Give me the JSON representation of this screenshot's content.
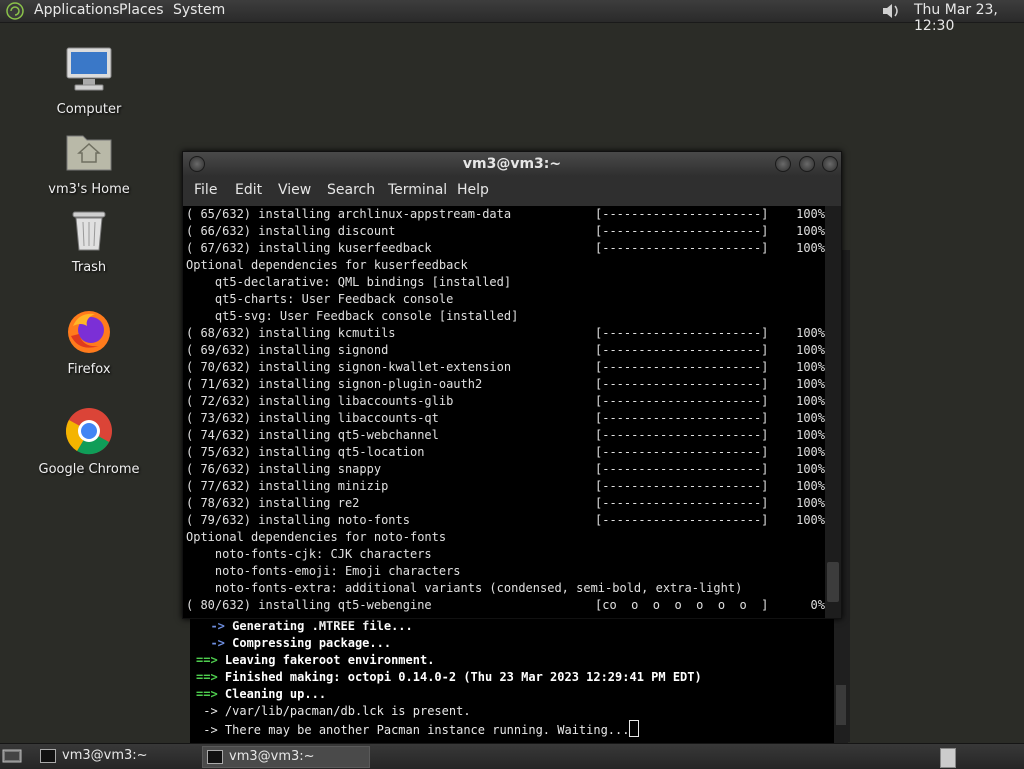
{
  "top_panel": {
    "menus": [
      "Applications",
      "Places",
      "System"
    ],
    "clock": "Thu Mar 23, 12:30"
  },
  "desktop_icons": [
    {
      "label": "Computer",
      "icon": "computer-icon"
    },
    {
      "label": "vm3's Home",
      "icon": "home-folder-icon"
    },
    {
      "label": "Trash",
      "icon": "trash-icon"
    },
    {
      "label": "Firefox",
      "icon": "firefox-icon"
    },
    {
      "label": "Google Chrome",
      "icon": "chrome-icon"
    }
  ],
  "terminal_front": {
    "title": "vm3@vm3:~",
    "menu": [
      "File",
      "Edit",
      "View",
      "Search",
      "Terminal",
      "Help"
    ],
    "lines": [
      {
        "text": "( 65/632) installing archlinux-appstream-data",
        "bar": "[----------------------]",
        "pct": "100%"
      },
      {
        "text": "( 66/632) installing discount",
        "bar": "[----------------------]",
        "pct": "100%"
      },
      {
        "text": "( 67/632) installing kuserfeedback",
        "bar": "[----------------------]",
        "pct": "100%"
      },
      {
        "text": "Optional dependencies for kuserfeedback"
      },
      {
        "text": "    qt5-declarative: QML bindings [installed]"
      },
      {
        "text": "    qt5-charts: User Feedback console"
      },
      {
        "text": "    qt5-svg: User Feedback console [installed]"
      },
      {
        "text": "( 68/632) installing kcmutils",
        "bar": "[----------------------]",
        "pct": "100%"
      },
      {
        "text": "( 69/632) installing signond",
        "bar": "[----------------------]",
        "pct": "100%"
      },
      {
        "text": "( 70/632) installing signon-kwallet-extension",
        "bar": "[----------------------]",
        "pct": "100%"
      },
      {
        "text": "( 71/632) installing signon-plugin-oauth2",
        "bar": "[----------------------]",
        "pct": "100%"
      },
      {
        "text": "( 72/632) installing libaccounts-glib",
        "bar": "[----------------------]",
        "pct": "100%"
      },
      {
        "text": "( 73/632) installing libaccounts-qt",
        "bar": "[----------------------]",
        "pct": "100%"
      },
      {
        "text": "( 74/632) installing qt5-webchannel",
        "bar": "[----------------------]",
        "pct": "100%"
      },
      {
        "text": "( 75/632) installing qt5-location",
        "bar": "[----------------------]",
        "pct": "100%"
      },
      {
        "text": "( 76/632) installing snappy",
        "bar": "[----------------------]",
        "pct": "100%"
      },
      {
        "text": "( 77/632) installing minizip",
        "bar": "[----------------------]",
        "pct": "100%"
      },
      {
        "text": "( 78/632) installing re2",
        "bar": "[----------------------]",
        "pct": "100%"
      },
      {
        "text": "( 79/632) installing noto-fonts",
        "bar": "[----------------------]",
        "pct": "100%"
      },
      {
        "text": "Optional dependencies for noto-fonts"
      },
      {
        "text": "    noto-fonts-cjk: CJK characters"
      },
      {
        "text": "    noto-fonts-emoji: Emoji characters"
      },
      {
        "text": "    noto-fonts-extra: additional variants (condensed, semi-bold, extra-light)"
      },
      {
        "text": "( 80/632) installing qt5-webengine",
        "bar": "[co  o  o  o  o  o  o  ]",
        "pct": "0%"
      }
    ]
  },
  "terminal_back": {
    "lines": [
      {
        "prefix": "  -> ",
        "text": "Generating .MTREE file...",
        "style": "bold"
      },
      {
        "prefix": "  -> ",
        "text": "Compressing package...",
        "style": "bold"
      },
      {
        "prefix": "==> ",
        "text": "Leaving fakeroot environment.",
        "style": "bold"
      },
      {
        "prefix": "==> ",
        "text": "Finished making: octopi 0.14.0-2 (Thu 23 Mar 2023 12:29:41 PM EDT)",
        "style": "bold"
      },
      {
        "prefix": "==> ",
        "text": "Cleaning up...",
        "style": "bold"
      },
      {
        "prefix": " -> ",
        "text": "/var/lib/pacman/db.lck is present.",
        "style": "normal"
      },
      {
        "prefix": " -> ",
        "text": "There may be another Pacman instance running. Waiting...",
        "style": "normal"
      }
    ]
  },
  "taskbar": {
    "tasks": [
      "vm3@vm3:~",
      "vm3@vm3:~"
    ]
  }
}
